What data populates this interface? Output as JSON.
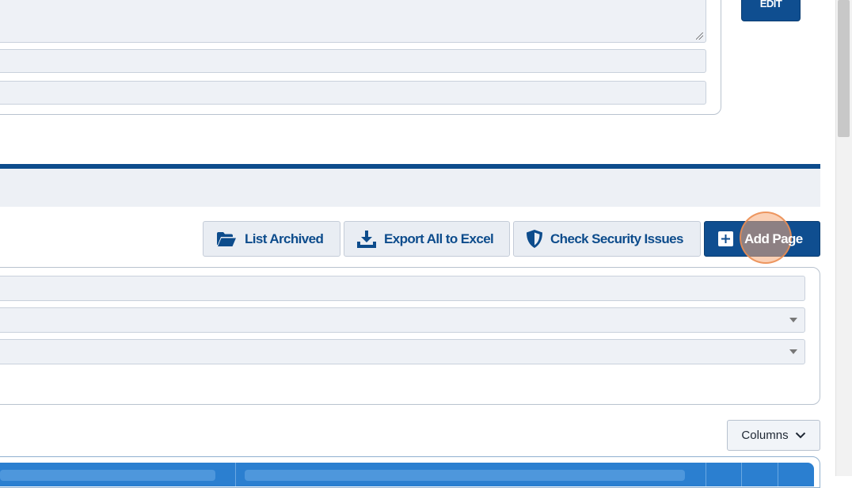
{
  "top_form": {
    "edit_label": "EDIT"
  },
  "toolbar": {
    "list_archived_label": "List Archived",
    "export_excel_label": "Export All to Excel",
    "check_security_label": "Check Security Issues",
    "add_page_label": "Add Page"
  },
  "filters": {
    "search_value": "",
    "select1_value": "",
    "select2_value": ""
  },
  "table": {
    "columns_label": "Columns"
  },
  "icons": {
    "list_archived": "folder-open-icon",
    "export_excel": "download-tray-icon",
    "check_security": "shield-icon",
    "add_page": "plus-square-icon",
    "columns": "chevron-down-icon"
  },
  "colors": {
    "primary": "#0f4e90",
    "section_bar": "#0d4c8c",
    "table_header": "#2b7fd0",
    "click_highlight": "#f5aa78"
  }
}
